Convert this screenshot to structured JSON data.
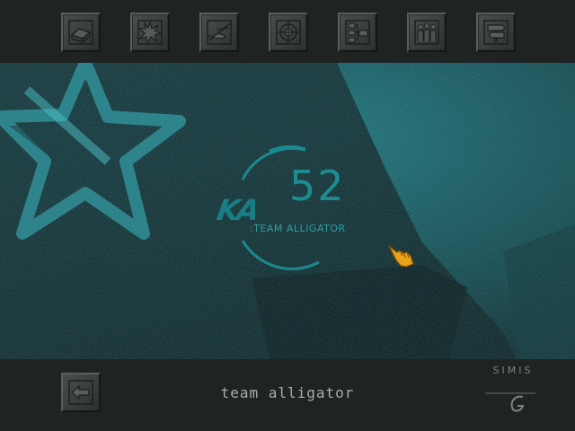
{
  "toolbar": {
    "icons": [
      "briefing-book-icon",
      "explosion-icon",
      "helicopter-icon",
      "target-reticle-icon",
      "network-diagram-icon",
      "pilots-group-icon",
      "signpost-icon"
    ]
  },
  "logo": {
    "mark": "KA",
    "number": "52",
    "subtitle": ":TEAM ALLIGATOR"
  },
  "footer": {
    "caption": "team alligator",
    "back_icon": "back-arrow-icon",
    "publisher": "SIMIS"
  },
  "colors": {
    "panel": "#1f2322",
    "scene": "#0c2227",
    "accent": "#1e8d91",
    "cursor": "#e9a21a"
  }
}
